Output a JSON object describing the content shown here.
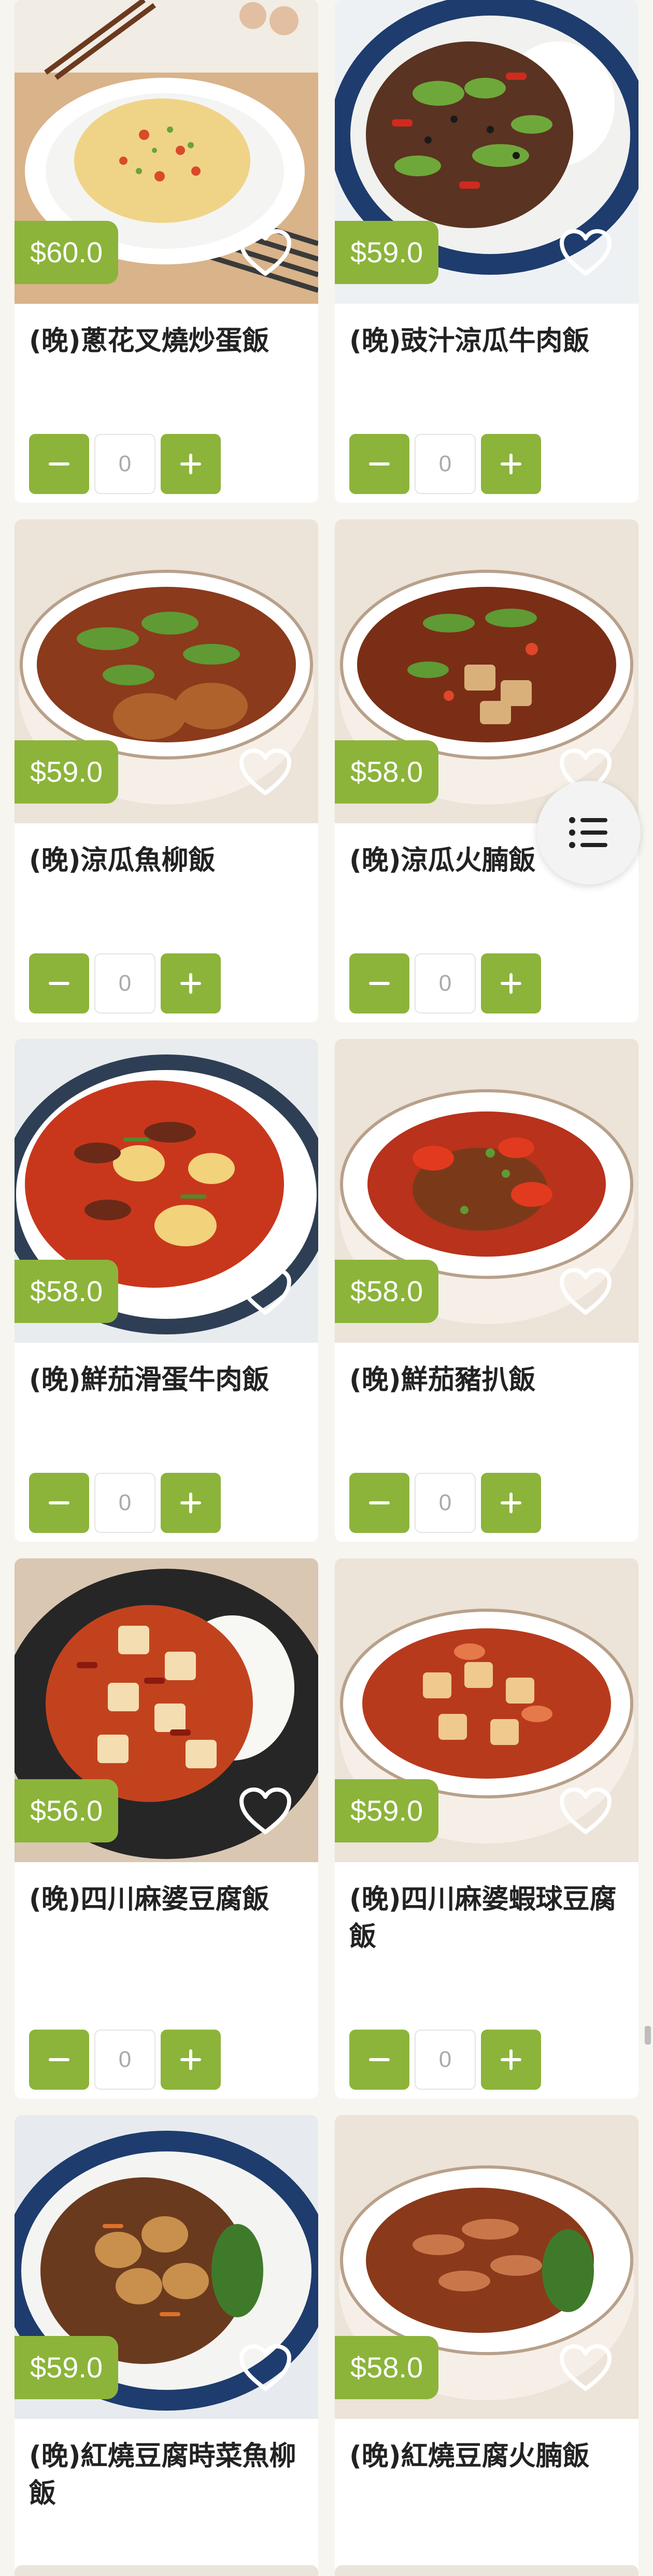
{
  "menu": {
    "items": [
      {
        "name": "(晚)蔥花叉燒炒蛋飯",
        "price": "$60.0",
        "qty": "0"
      },
      {
        "name": "(晚)豉汁涼瓜牛肉飯",
        "price": "$59.0",
        "qty": "0"
      },
      {
        "name": "(晚)涼瓜魚柳飯",
        "price": "$59.0",
        "qty": "0"
      },
      {
        "name": "(晚)涼瓜火腩飯",
        "price": "$58.0",
        "qty": "0"
      },
      {
        "name": "(晚)鮮茄滑蛋牛肉飯",
        "price": "$58.0",
        "qty": "0"
      },
      {
        "name": "(晚)鮮茄豬扒飯",
        "price": "$58.0",
        "qty": "0"
      },
      {
        "name": "(晚)四川麻婆豆腐飯",
        "price": "$56.0",
        "qty": "0"
      },
      {
        "name": "(晚)四川麻婆蝦球豆腐飯",
        "price": "$59.0",
        "qty": "0"
      },
      {
        "name": "(晚)紅燒豆腐時菜魚柳飯",
        "price": "$59.0",
        "qty": "0"
      },
      {
        "name": "(晚)紅燒豆腐火腩飯",
        "price": "$58.0",
        "qty": "0"
      }
    ]
  },
  "colors": {
    "accent": "#8cb43a",
    "background": "#f6f5ef"
  },
  "icons": {
    "favorite": "heart-icon",
    "menu": "list-icon"
  }
}
